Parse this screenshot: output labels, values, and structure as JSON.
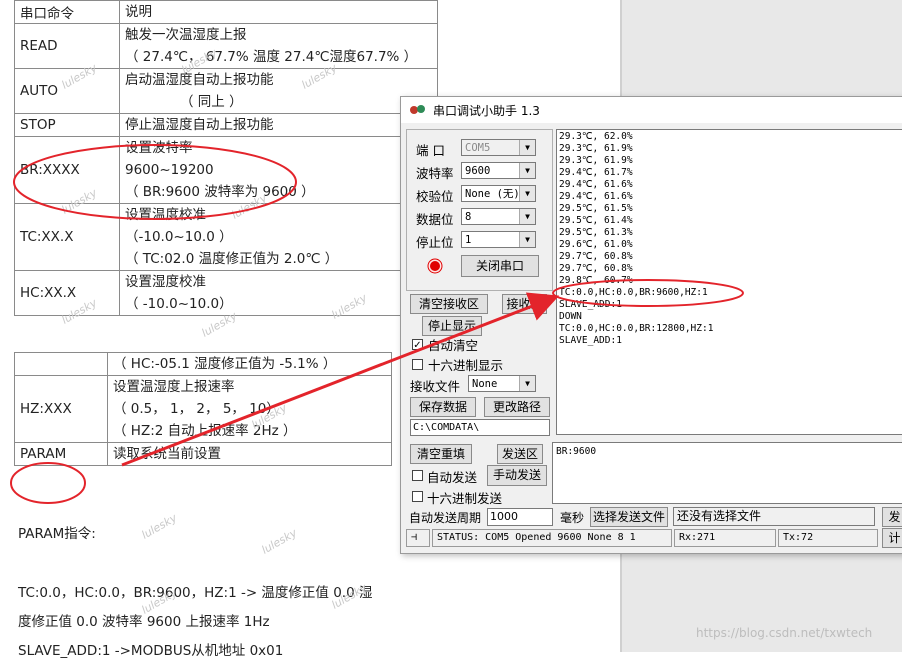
{
  "doc": {
    "table1": [
      {
        "cmd": "串口命令",
        "desc": [
          "说明"
        ]
      },
      {
        "cmd": "READ",
        "desc": [
          "触发一次温湿度上报",
          "（ 27.4℃， 67.7%  温度  27.4℃湿度67.7%  ）"
        ]
      },
      {
        "cmd": "AUTO",
        "desc": [
          "启动温湿度自动上报功能",
          "（ 同上 ）"
        ]
      },
      {
        "cmd": "STOP",
        "desc": [
          "停止温湿度自动上报功能"
        ]
      },
      {
        "cmd": "BR:XXXX",
        "desc": [
          "设置波特率",
          "9600~19200",
          "（ BR:9600 波特率为 9600 ）"
        ]
      },
      {
        "cmd": "TC:XX.X",
        "desc": [
          "设置温度校准",
          "（-10.0~10.0 ）",
          "（ TC:02.0 温度修正值为 2.0℃ ）"
        ]
      },
      {
        "cmd": "HC:XX.X",
        "desc": [
          "设置湿度校准",
          "（ -10.0~10.0）"
        ]
      }
    ],
    "table2": [
      {
        "cmd": "",
        "desc": [
          "（ HC:-05.1 湿度修正值为 -5.1% ）"
        ]
      },
      {
        "cmd": "HZ:XXX",
        "desc": [
          "设置温湿度上报速率",
          "（ 0.5， 1， 2， 5， 10）",
          "（ HZ:2 自动上报速率 2Hz ）"
        ]
      },
      {
        "cmd": "PARAM",
        "desc": [
          "读取系统当前设置"
        ]
      }
    ],
    "param_heading": "PARAM指令:",
    "param_line1": "TC:0.0，HC:0.0，BR:9600，HZ:1  -> 温度修正值 0.0 湿",
    "param_line2": "度修正值 0.0 波特率 9600 上报速率 1Hz",
    "param_line3": "SLAVE_ADD:1      ->MODBUS从机地址 0x01",
    "watermark": "lulesky"
  },
  "app": {
    "title": "串口调试小助手 1.3",
    "port_label": "端  口",
    "port_value": "COM5",
    "baud_label": "波特率",
    "baud_value": "9600",
    "parity_label": "校验位",
    "parity_value": "None (无)",
    "databits_label": "数据位",
    "databits_value": "8",
    "stopbits_label": "停止位",
    "stopbits_value": "1",
    "close_port": "关闭串口",
    "clear_recv": "清空接收区",
    "recv_area": "接收区",
    "stop_display": "停止显示",
    "auto_clear": "自动清空",
    "hex_display": "十六进制显示",
    "recv_file_label": "接收文件",
    "recv_file_value": "None",
    "save_data": "保存数据",
    "change_path": "更改路径",
    "path": "C:\\COMDATA\\",
    "recv_lines": [
      "29.3℃, 62.0%",
      "29.3℃, 61.9%",
      "29.3℃, 61.9%",
      "29.4℃, 61.7%",
      "29.4℃, 61.6%",
      "29.4℃, 61.6%",
      "29.5℃, 61.5%",
      "29.5℃, 61.4%",
      "29.5℃, 61.3%",
      "29.6℃, 61.0%",
      "29.7℃, 60.8%",
      "29.7℃, 60.8%",
      "29.8℃, 60.7%",
      "TC:0.0,HC:0.0,BR:9600,HZ:1",
      "SLAVE_ADD:1",
      "DOWN",
      "TC:0.0,HC:0.0,BR:12800,HZ:1",
      "SLAVE_ADD:1"
    ],
    "clear_send": "清空重填",
    "send_area": "发送区",
    "auto_send": "自动发送",
    "manual_send": "手动发送",
    "hex_send": "十六进制发送",
    "send_text": "BR:9600",
    "period_label": "自动发送周期",
    "period_value": "1000",
    "ms_label": "毫秒",
    "select_file": "选择发送文件",
    "no_file": "还没有选择文件",
    "send_btn": "发",
    "calc_btn": "计",
    "status": "STATUS: COM5 Opened 9600 None  8 1",
    "rx": "Rx:271",
    "tx": "Tx:72"
  },
  "url": "https://blog.csdn.net/txwtech",
  "colors": {
    "annotation": "#e3242b",
    "indicator": "#e00000"
  }
}
